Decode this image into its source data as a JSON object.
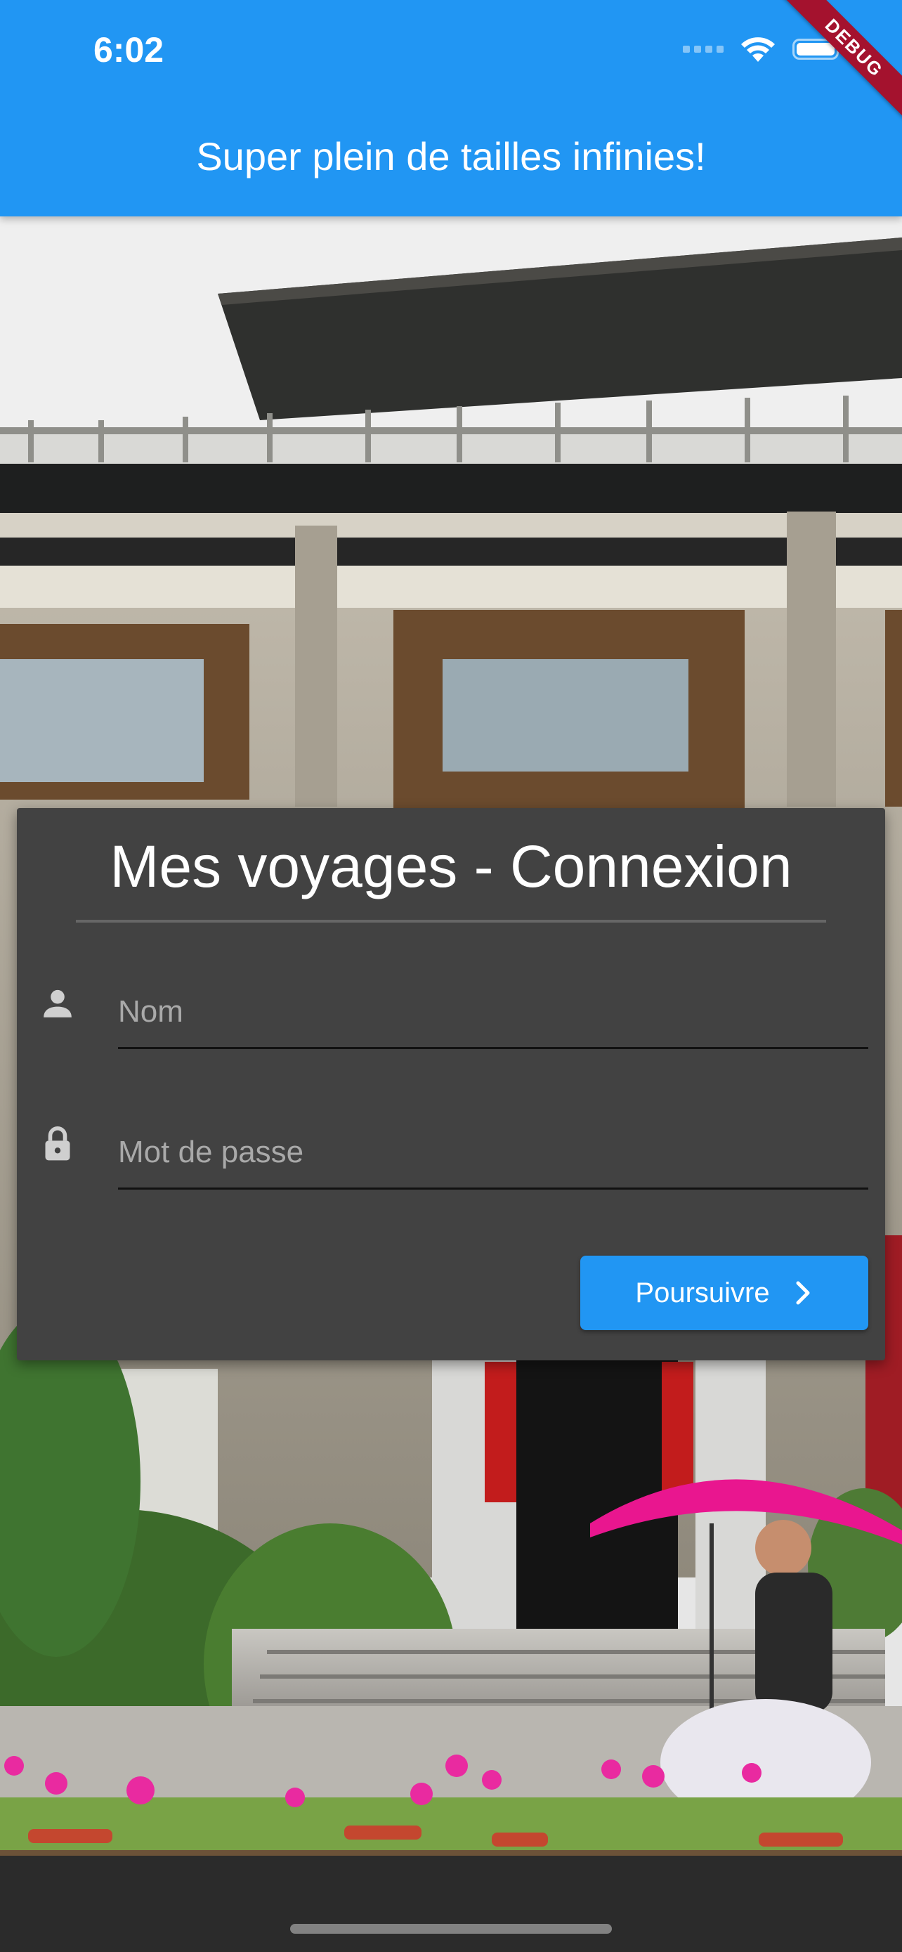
{
  "status_bar": {
    "time": "6:02",
    "icons": [
      "cellular-signal-icon",
      "wifi-icon",
      "battery-icon"
    ]
  },
  "debug_banner": "DEBUG",
  "app_bar": {
    "title": "Super plein de tailles infinies!",
    "color": "#2196F3"
  },
  "background": {
    "image": "photo of a traditional Chinese building with shrubs, pink flowers, a red banner, and a man riding a scooter under a pink umbrella"
  },
  "login_card": {
    "title": "Mes voyages - Connexion",
    "background_color": "#424242",
    "fields": {
      "name": {
        "icon": "person-icon",
        "placeholder": "Nom",
        "value": ""
      },
      "password": {
        "icon": "lock-icon",
        "placeholder": "Mot de passe",
        "value": ""
      }
    },
    "submit_button": {
      "label": "Poursuivre",
      "icon": "chevron-right-icon",
      "color": "#2196F3"
    }
  }
}
